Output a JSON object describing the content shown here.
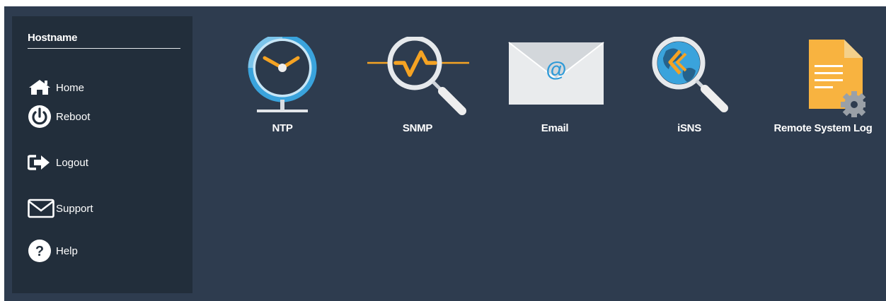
{
  "sidebar": {
    "title": "Hostname",
    "items": [
      {
        "label": "Home",
        "icon": "home-icon"
      },
      {
        "label": "Reboot",
        "icon": "power-icon"
      },
      {
        "label": "Logout",
        "icon": "logout-icon"
      },
      {
        "label": "Support",
        "icon": "envelope-icon"
      },
      {
        "label": "Help",
        "icon": "question-icon"
      }
    ]
  },
  "services": [
    {
      "label": "NTP",
      "icon": "ntp-clock-icon"
    },
    {
      "label": "SNMP",
      "icon": "snmp-magnifier-icon"
    },
    {
      "label": "Email",
      "icon": "email-envelope-icon"
    },
    {
      "label": "iSNS",
      "icon": "isns-globe-magnifier-icon"
    },
    {
      "label": "Remote System Log",
      "icon": "remote-log-document-icon"
    }
  ],
  "colors": {
    "background": "#2e3c4f",
    "sidebar": "#222e3b",
    "accent_blue": "#3aa3dc",
    "accent_orange": "#f5a323",
    "text": "#ffffff"
  }
}
